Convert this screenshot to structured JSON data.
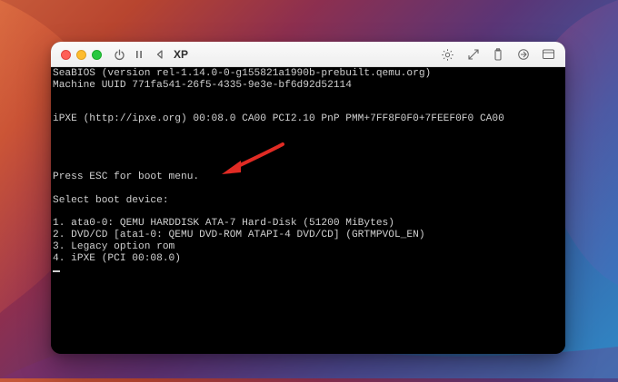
{
  "app": {
    "window_title": "XP"
  },
  "icons": {
    "power": "power-icon",
    "pause": "pause-icon",
    "back": "back-icon",
    "brightness": "brightness-icon",
    "resize": "resize-icon",
    "usb": "usb-icon",
    "share": "share-icon",
    "window": "window-icon"
  },
  "console": {
    "lines": [
      "SeaBIOS (version rel-1.14.0-0-g155821a1990b-prebuilt.qemu.org)",
      "Machine UUID 771fa541-26f5-4335-9e3e-bf6d92d52114",
      "",
      "",
      "iPXE (http://ipxe.org) 00:08.0 CA00 PCI2.10 PnP PMM+7FF8F0F0+7FEEF0F0 CA00",
      "",
      "",
      "",
      "",
      "Press ESC for boot menu.",
      "",
      "Select boot device:",
      "",
      "1. ata0-0: QEMU HARDDISK ATA-7 Hard-Disk (51200 MiBytes)",
      "2. DVD/CD [ata1-0: QEMU DVD-ROM ATAPI-4 DVD/CD] (GRTMPVOL_EN)",
      "3. Legacy option rom",
      "4. iPXE (PCI 00:08.0)"
    ]
  },
  "colors": {
    "annotation_arrow": "#e12b24",
    "console_text": "#cfcfcf",
    "console_background": "#000000"
  }
}
